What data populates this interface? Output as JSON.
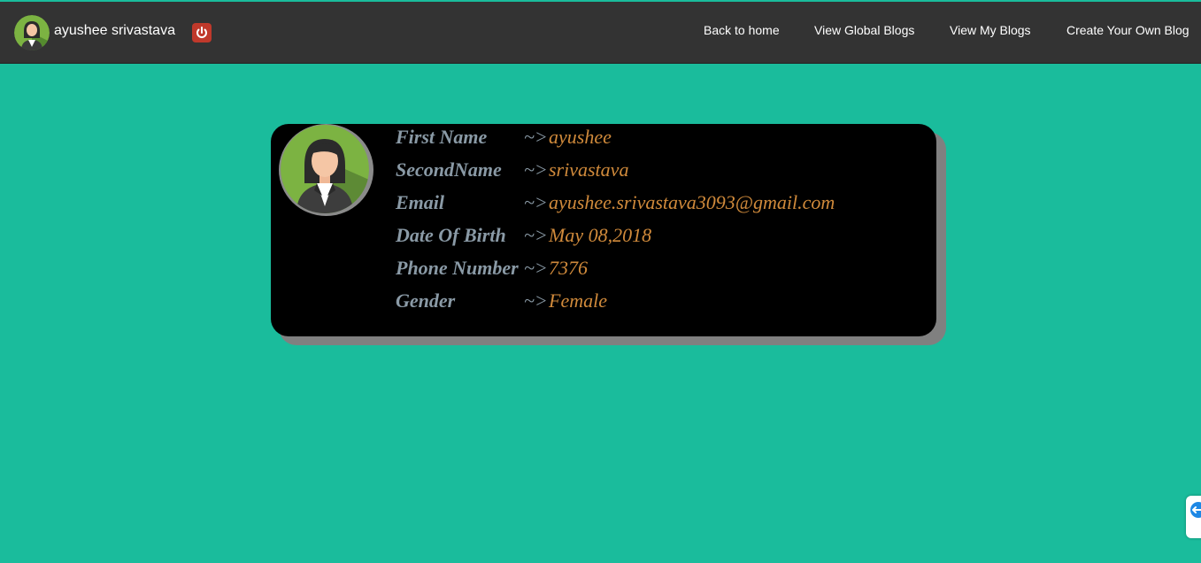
{
  "navbar": {
    "username": "ayushee srivastava",
    "avatar_icon": "user-avatar-icon",
    "logout_icon": "power-icon",
    "links": [
      {
        "label": "Back to home"
      },
      {
        "label": "View Global Blogs"
      },
      {
        "label": "View My Blogs"
      },
      {
        "label": "Create Your Own Blog"
      }
    ]
  },
  "profile": {
    "separator": "~>",
    "fields": [
      {
        "label": "First Name",
        "value": "ayushee"
      },
      {
        "label": "SecondName",
        "value": "srivastava"
      },
      {
        "label": "Email",
        "value": "ayushee.srivastava3093@gmail.com"
      },
      {
        "label": "Date Of Birth",
        "value": "May 08,2018"
      },
      {
        "label": "Phone Number",
        "value": "7376"
      },
      {
        "label": "Gender",
        "value": "Female"
      }
    ]
  },
  "colors": {
    "background": "#1abc9c",
    "navbar": "#333333",
    "card": "#000000",
    "label": "#8a9aa6",
    "value": "#d08a3b",
    "logout": "#c0392b"
  }
}
